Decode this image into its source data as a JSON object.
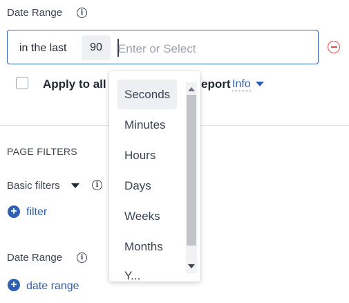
{
  "date_range": {
    "label": "Date Range",
    "prefix": "in the last",
    "value": "90",
    "placeholder": "Enter or Select",
    "apply_label": "Apply to all",
    "apply_suffix": "eport",
    "info_link": "Info"
  },
  "page_filters": {
    "heading": "PAGE FILTERS",
    "basic_filters_label": "Basic filters",
    "add_filter_label": "filter",
    "date_range_label": "Date Range",
    "add_date_range_label": "date range"
  },
  "dropdown": {
    "options": [
      "Seconds",
      "Minutes",
      "Hours",
      "Days",
      "Weeks",
      "Months"
    ],
    "selected": "Seconds",
    "partial_option": "Y..."
  },
  "colors": {
    "accent": "#2f5fb3",
    "danger": "#e5484d",
    "selected_bg": "#eef0f3"
  }
}
